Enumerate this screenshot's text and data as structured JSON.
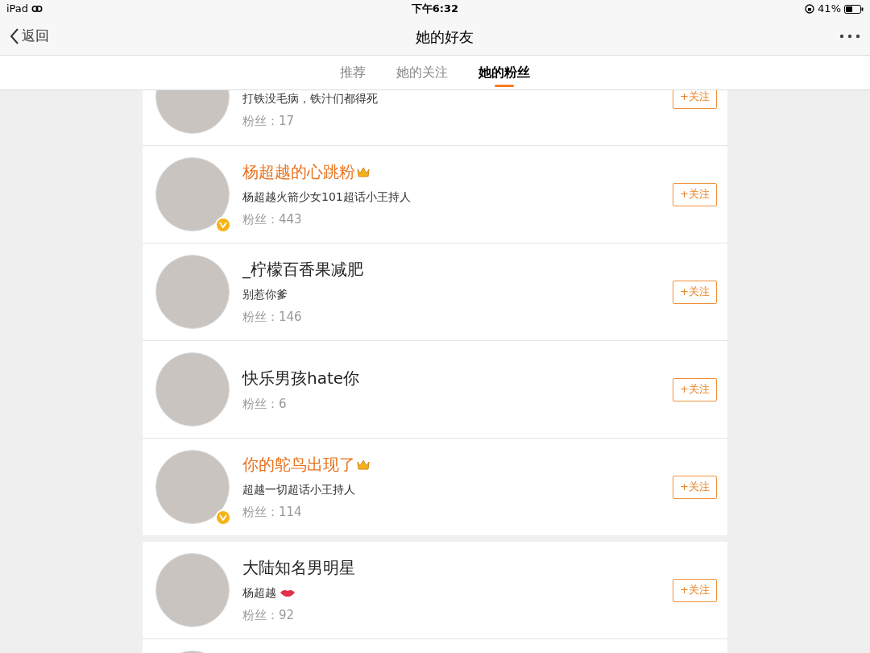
{
  "status_bar": {
    "device": "iPad",
    "time": "下午6:32",
    "battery": "41%"
  },
  "nav": {
    "back": "返回",
    "title": "她的好友"
  },
  "tabs": [
    {
      "label": "推荐",
      "selected": false
    },
    {
      "label": "她的关注",
      "selected": false
    },
    {
      "label": "她的粉丝",
      "selected": true
    }
  ],
  "groups": [
    [
      {
        "bio": "打铁没毛病，铁汁们都得死",
        "fans": "粉丝：17",
        "follow": "+关注",
        "verified": false,
        "vip": false
      },
      {
        "name": "杨超越的心跳粉",
        "bio": "杨超越火箭少女101超话小王持人",
        "fans": "粉丝：443",
        "follow": "+关注",
        "verified": true,
        "vip": true
      },
      {
        "name": "_柠檬百香果减肥",
        "bio": "别惹你爹",
        "fans": "粉丝：146",
        "follow": "+关注",
        "verified": false,
        "vip": false
      },
      {
        "name": "快乐男孩hate你",
        "fans": "粉丝：6",
        "follow": "+关注",
        "verified": false,
        "vip": false
      },
      {
        "name": "你的鸵鸟出现了",
        "bio": "超越一切超话小王持人",
        "fans": "粉丝：114",
        "follow": "+关注",
        "verified": true,
        "vip": true
      }
    ],
    [
      {
        "name": "大陆知名男明星",
        "bio": "杨超越",
        "bio_lips_icon": true,
        "fans": "粉丝：92",
        "follow": "+关注",
        "verified": false,
        "vip": false
      },
      {
        "verified": false,
        "vip": false
      }
    ]
  ]
}
